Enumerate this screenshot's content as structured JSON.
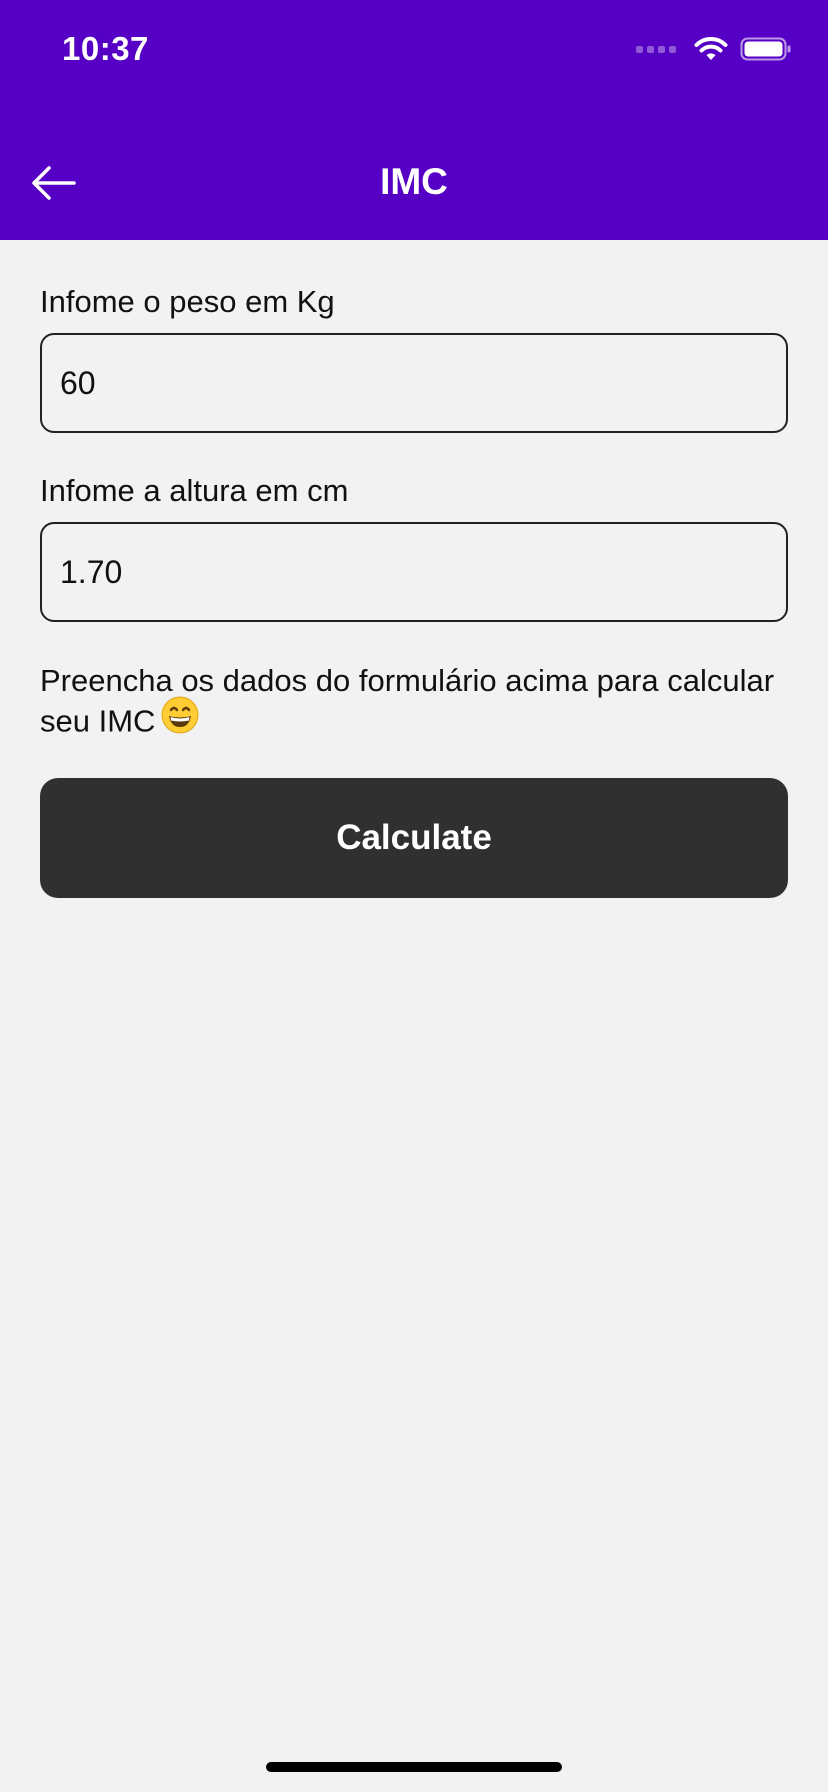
{
  "status_bar": {
    "time": "10:37",
    "icons": [
      "signal-icon",
      "wifi-icon",
      "battery-icon"
    ]
  },
  "app_bar": {
    "title": "IMC",
    "back_icon": "arrow-left-icon",
    "background": "#5500c4"
  },
  "form": {
    "weight": {
      "label": "Infome o peso em Kg",
      "value": "60"
    },
    "height": {
      "label": "Infome a altura em cm",
      "value": "1.70"
    },
    "hint": {
      "text": "Preencha os dados do formulário acima para calcular seu IMC",
      "emoji": "grinning-face-icon"
    },
    "calculate_label": "Calculate",
    "button_color": "#303030"
  }
}
